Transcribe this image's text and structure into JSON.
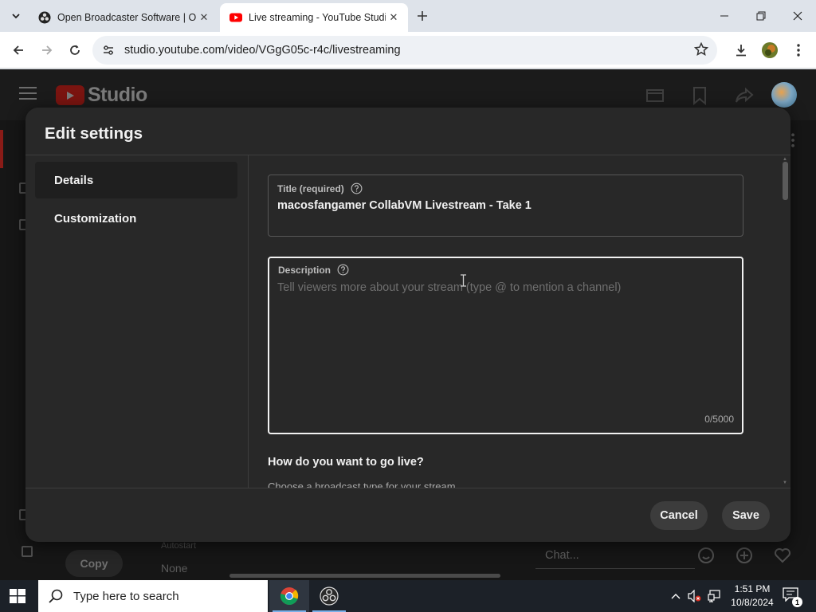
{
  "browser": {
    "tabs": [
      {
        "title": "Open Broadcaster Software | OBS",
        "favicon": "obs-icon",
        "active": false
      },
      {
        "title": "Live streaming - YouTube Studio",
        "favicon": "youtube-icon",
        "active": true
      }
    ],
    "address": "studio.youtube.com/video/VGgG05c-r4c/livestreaming"
  },
  "studio": {
    "logo_text": "Studio",
    "copy_label": "Copy",
    "setting_label": "Autostart",
    "setting_value": "None",
    "chat_placeholder": "Chat..."
  },
  "modal": {
    "title": "Edit settings",
    "nav": [
      {
        "label": "Details",
        "active": true
      },
      {
        "label": "Customization",
        "active": false
      }
    ],
    "title_field": {
      "label": "Title (required)",
      "value": "macosfangamer CollabVM Livestream - Take 1"
    },
    "description_field": {
      "label": "Description",
      "placeholder": "Tell viewers more about your stream (type @ to mention a channel)",
      "counter": "0/5000"
    },
    "section_heading": "How do you want to go live?",
    "section_subtext": "Choose a broadcast type for your stream",
    "cancel_label": "Cancel",
    "save_label": "Save"
  },
  "taskbar": {
    "search_placeholder": "Type here to search",
    "time": "1:51 PM",
    "date": "10/8/2024",
    "notification_count": "1"
  },
  "colors": {
    "modal_bg": "#282828",
    "page_bg": "#161616",
    "accent_red": "#ff0000",
    "text_primary": "#f1f1f1"
  }
}
